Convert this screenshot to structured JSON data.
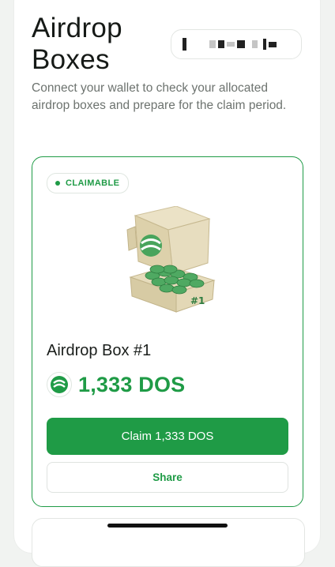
{
  "header": {
    "title": "Airdrop\nBoxes",
    "wallet_display": "",
    "subtitle": "Connect your wallet to check your allocated airdrop boxes and prepare for the claim period."
  },
  "box": {
    "status": "CLAIMABLE",
    "box_label": "#1",
    "name": "Airdrop Box #1",
    "amount": "1,333 DOS",
    "claim_label": "Claim 1,333 DOS",
    "share_label": "Share"
  },
  "colors": {
    "accent": "#1f9b46",
    "box_tan": "#e2d7b4",
    "coin": "#4fa962"
  }
}
